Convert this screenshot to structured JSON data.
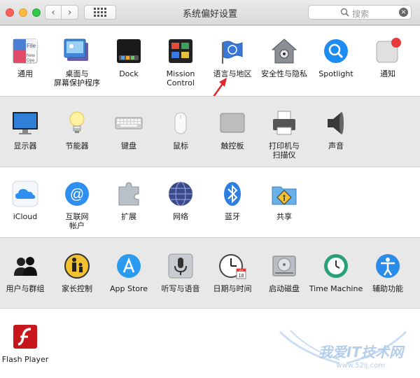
{
  "window": {
    "title": "系统偏好设置"
  },
  "toolbar": {
    "back": "‹",
    "forward": "›"
  },
  "search": {
    "placeholder": "搜索",
    "clear": "×"
  },
  "rows": [
    {
      "items": [
        {
          "id": "general",
          "label": "通用",
          "icon": "general-icon"
        },
        {
          "id": "desktop",
          "label": "桌面与\n屏幕保护程序",
          "icon": "desktop-screensaver-icon"
        },
        {
          "id": "dock",
          "label": "Dock",
          "icon": "dock-icon"
        },
        {
          "id": "mission",
          "label": "Mission\nControl",
          "icon": "mission-control-icon"
        },
        {
          "id": "language",
          "label": "语言与地区",
          "icon": "language-region-icon"
        },
        {
          "id": "security",
          "label": "安全性与隐私",
          "icon": "security-privacy-icon"
        },
        {
          "id": "spotlight",
          "label": "Spotlight",
          "icon": "spotlight-icon"
        },
        {
          "id": "notifications",
          "label": "通知",
          "icon": "notifications-icon"
        }
      ]
    },
    {
      "items": [
        {
          "id": "displays",
          "label": "显示器",
          "icon": "displays-icon"
        },
        {
          "id": "energy",
          "label": "节能器",
          "icon": "energy-saver-icon"
        },
        {
          "id": "keyboard",
          "label": "键盘",
          "icon": "keyboard-icon"
        },
        {
          "id": "mouse",
          "label": "鼠标",
          "icon": "mouse-icon"
        },
        {
          "id": "trackpad",
          "label": "触控板",
          "icon": "trackpad-icon"
        },
        {
          "id": "printers",
          "label": "打印机与\n扫描仪",
          "icon": "printers-scanners-icon"
        },
        {
          "id": "sound",
          "label": "声音",
          "icon": "sound-icon"
        }
      ]
    },
    {
      "items": [
        {
          "id": "icloud",
          "label": "iCloud",
          "icon": "icloud-icon"
        },
        {
          "id": "internet",
          "label": "互联网\n帐户",
          "icon": "internet-accounts-icon"
        },
        {
          "id": "extensions",
          "label": "扩展",
          "icon": "extensions-icon"
        },
        {
          "id": "network",
          "label": "网络",
          "icon": "network-icon"
        },
        {
          "id": "bluetooth",
          "label": "蓝牙",
          "icon": "bluetooth-icon"
        },
        {
          "id": "sharing",
          "label": "共享",
          "icon": "sharing-icon"
        }
      ]
    },
    {
      "items": [
        {
          "id": "users",
          "label": "用户与群组",
          "icon": "users-groups-icon"
        },
        {
          "id": "parental",
          "label": "家长控制",
          "icon": "parental-controls-icon"
        },
        {
          "id": "appstore",
          "label": "App Store",
          "icon": "app-store-icon"
        },
        {
          "id": "dictation",
          "label": "听写与语音",
          "icon": "dictation-speech-icon"
        },
        {
          "id": "datetime",
          "label": "日期与时间",
          "icon": "date-time-icon"
        },
        {
          "id": "startup",
          "label": "启动磁盘",
          "icon": "startup-disk-icon"
        },
        {
          "id": "timemachine",
          "label": "Time Machine",
          "icon": "time-machine-icon"
        },
        {
          "id": "accessibility",
          "label": "辅助功能",
          "icon": "accessibility-icon"
        }
      ]
    },
    {
      "items": [
        {
          "id": "flash",
          "label": "Flash Player",
          "icon": "flash-player-icon"
        }
      ]
    }
  ],
  "icon_text": {
    "general_file": "File",
    "general_new": "New",
    "general_open": "Ope",
    "calendar_month": "JUL",
    "calendar_day": "18"
  },
  "watermark": {
    "text": "我爱IT技术网",
    "sub": "www.52ij.com"
  },
  "colors": {
    "accent": "#1a82fb",
    "annotation_arrow": "#e0262b",
    "section_gray": "#e8e8e8"
  }
}
